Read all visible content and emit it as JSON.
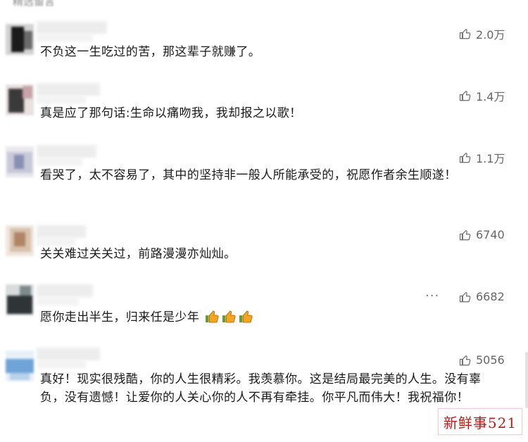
{
  "top_partial_text": "精选留言",
  "comments": [
    {
      "text": "不负这一生吃过的苦，那这辈子就赚了。",
      "likes": "2.0万",
      "avatar_colors": [
        "#1b1b1b",
        "#6b6b6b",
        "#d2d2d2"
      ]
    },
    {
      "text": "真是应了那句话:生命以痛吻我，我却报之以歌！",
      "likes": "1.4万",
      "avatar_colors": [
        "#3a3a3a",
        "#c9a3a8",
        "#e9e0e0"
      ]
    },
    {
      "text": "看哭了，太不容易了，其中的坚持非一般人所能承受的，祝愿作者余生顺遂！",
      "likes": "1.1万",
      "avatar_colors": [
        "#8a8fb4",
        "#c7c9d8",
        "#e8e8ee"
      ]
    },
    {
      "text": "关关难过关关过，前路漫漫亦灿灿。",
      "likes": "6740",
      "avatar_colors": [
        "#b08466",
        "#d8c2ad",
        "#efe6dd"
      ]
    },
    {
      "text": "愿你走出半生，归来任是少年",
      "likes": "6682",
      "avatar_colors": [
        "#2f3436",
        "#7f8a8c",
        "#d9dcdc"
      ],
      "emoji_count": 3,
      "more_label": "···"
    },
    {
      "text": "真好！现实很残酷，你的人生很精彩。我羡慕你。这是结局最完美的人生。没有辜负，没有遗憾！让爱你的人关心你的人不再有牵挂。你平凡而伟大！我祝福你！",
      "likes": "5056",
      "avatar_colors": [
        "#6fa4d8",
        "#b7d2ec",
        "#e7f0f9"
      ]
    }
  ],
  "watermark": "新鲜事521",
  "icons": {
    "like": "thumbs-up-outline-icon",
    "emoji": "thumbs-up-emoji-icon",
    "more": "more-dots-icon"
  },
  "colors": {
    "text": "#1a1a1a",
    "like_count": "#666666",
    "watermark": "#c21818"
  }
}
